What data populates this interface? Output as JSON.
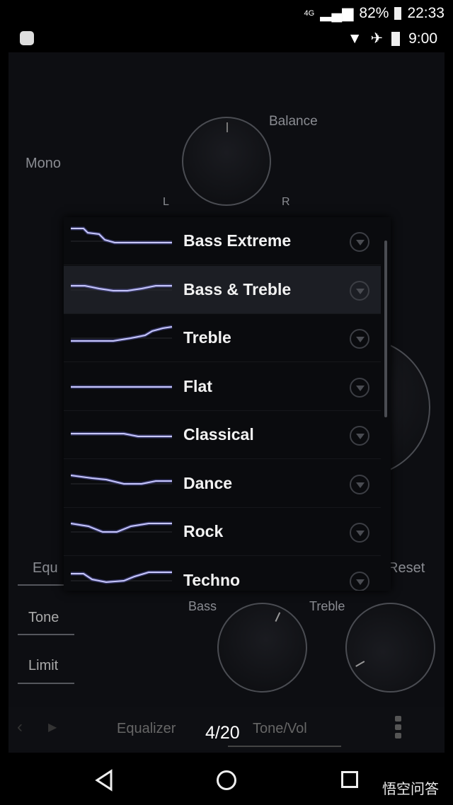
{
  "status": {
    "top_battery": "82%",
    "top_time": "22:33",
    "network": "4G",
    "bottom_time": "9:00"
  },
  "background": {
    "mono": "Mono",
    "balance": "Balance",
    "left": "L",
    "right": "R",
    "tab_equ": "Equ",
    "reset": "Reset",
    "tone": "Tone",
    "limit": "Limit",
    "bass": "Bass",
    "treble": "Treble"
  },
  "presets": [
    {
      "name": "Bass Extreme"
    },
    {
      "name": "Bass & Treble",
      "selected": true
    },
    {
      "name": "Treble"
    },
    {
      "name": "Flat"
    },
    {
      "name": "Classical"
    },
    {
      "name": "Dance"
    },
    {
      "name": "Rock"
    },
    {
      "name": "Techno"
    }
  ],
  "bottom_bar": {
    "equalizer": "Equalizer",
    "tone_vol": "Tone/Vol",
    "page_indicator": "4/20"
  },
  "watermark": "悟空问答",
  "colors": {
    "curve": "#c8c8ff",
    "background": "#0d0e12"
  }
}
